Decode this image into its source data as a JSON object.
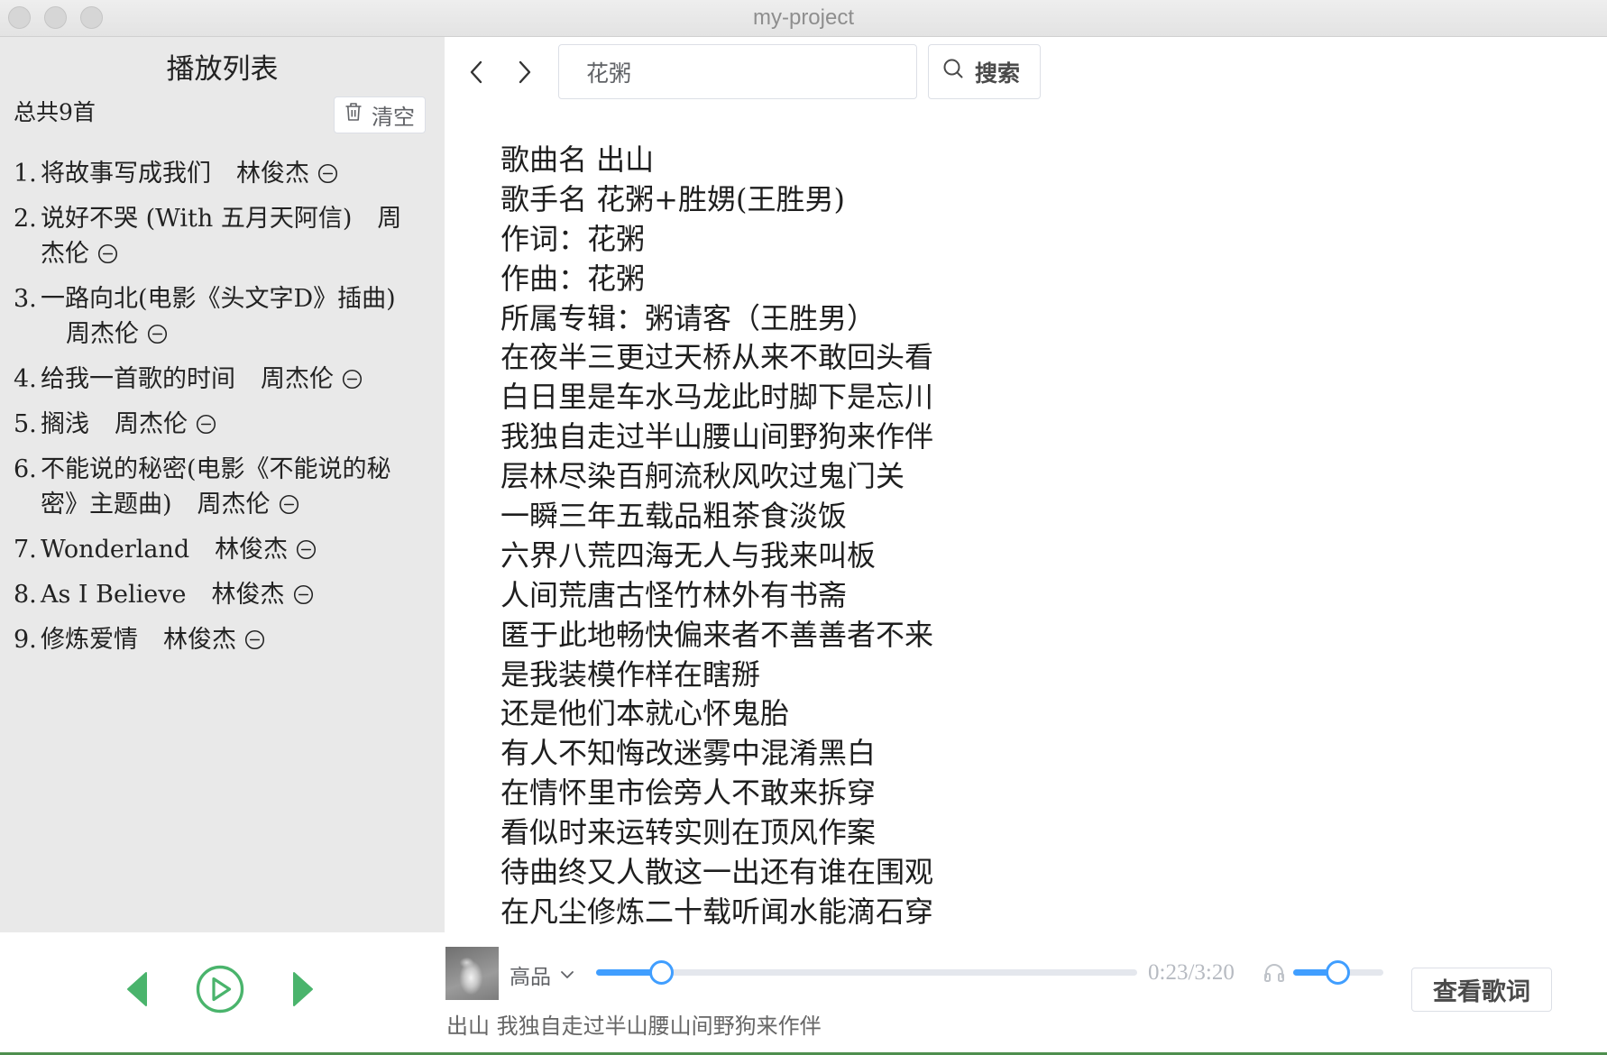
{
  "window": {
    "title": "my-project"
  },
  "colors": {
    "accent_green": "#4ab46c",
    "slider_blue": "#409eff"
  },
  "icons": {
    "clear": "trash-icon",
    "remove": "remove-circle-icon",
    "back": "chevron-left-icon",
    "forward": "chevron-right-icon",
    "search": "search-icon",
    "prev": "previous-track-icon",
    "play": "play-circle-icon",
    "next": "next-track-icon",
    "quality_dropdown": "chevron-down-icon",
    "volume": "headphones-icon"
  },
  "sidebar": {
    "heading": "播放列表",
    "total": "总共9首",
    "clear_label": "清空",
    "items": [
      {
        "no": "1.",
        "title": "将故事写成我们",
        "artist": "林俊杰"
      },
      {
        "no": "2.",
        "title": "说好不哭 (With 五月天阿信)",
        "artist": "周杰伦"
      },
      {
        "no": "3.",
        "title": "一路向北(电影《头文字D》插曲)",
        "artist": "周杰伦"
      },
      {
        "no": "4.",
        "title": "给我一首歌的时间",
        "artist": "周杰伦"
      },
      {
        "no": "5.",
        "title": "搁浅",
        "artist": "周杰伦"
      },
      {
        "no": "6.",
        "title": "不能说的秘密(电影《不能说的秘密》主题曲)",
        "artist": "周杰伦"
      },
      {
        "no": "7.",
        "title": "Wonderland",
        "artist": "林俊杰"
      },
      {
        "no": "8.",
        "title": "As I Believe",
        "artist": "林俊杰"
      },
      {
        "no": "9.",
        "title": "修炼爱情",
        "artist": "林俊杰"
      }
    ]
  },
  "search": {
    "value": "花粥",
    "button_label": "搜索"
  },
  "lyrics": {
    "lines": [
      "歌曲名 出山",
      "歌手名 花粥+胜娚(王胜男)",
      "作词：花粥",
      "作曲：花粥",
      "所属专辑：粥请客（王胜男）",
      "在夜半三更过天桥从来不敢回头看",
      "白日里是车水马龙此时脚下是忘川",
      "我独自走过半山腰山间野狗来作伴",
      "层林尽染百舸流秋风吹过鬼门关",
      "一瞬三年五载品粗茶食淡饭",
      "六界八荒四海无人与我来叫板",
      "人间荒唐古怪竹林外有书斋",
      "匿于此地畅快偏来者不善善者不来",
      "是我装模作样在瞎掰",
      "还是他们本就心怀鬼胎",
      "有人不知悔改迷雾中混淆黑白",
      "在情怀里市侩旁人不敢来拆穿",
      "看似时来运转实则在顶风作案",
      "待曲终又人散这一出还有谁在围观",
      "在凡尘修炼二十载听闻水能滴石穿"
    ]
  },
  "player": {
    "quality": "高品",
    "time": "0:23/3:20",
    "progress": 0.12,
    "volume": 0.49,
    "view_lyrics_label": "查看歌词",
    "now_playing": "出山 我独自走过半山腰山间野狗来作伴"
  }
}
